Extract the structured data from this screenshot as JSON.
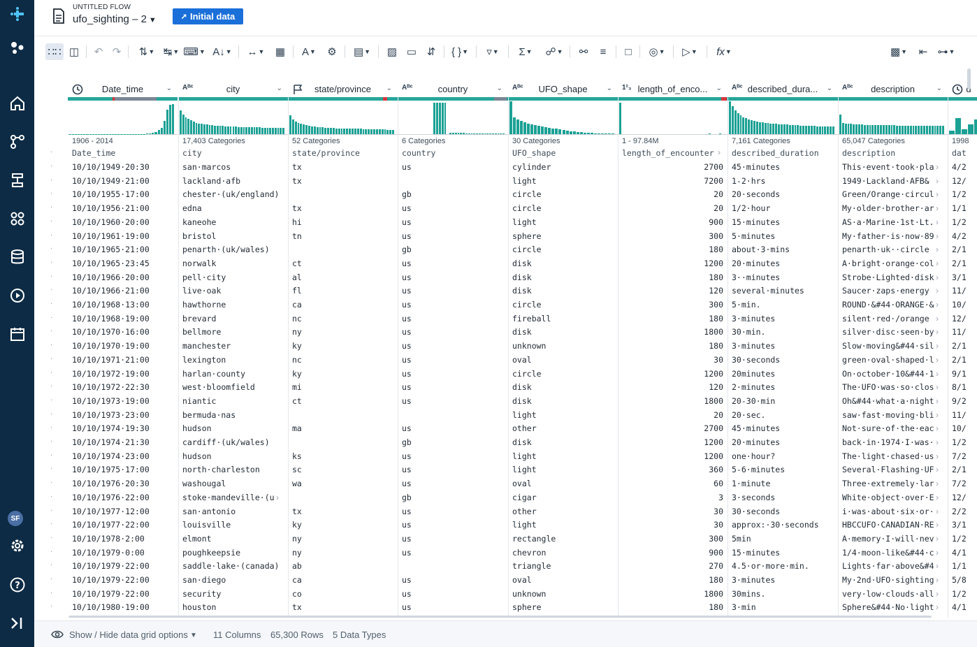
{
  "header": {
    "flow_label": "UNTITLED FLOW",
    "flow_name": "ufo_sighting – 2",
    "initial_button": "Initial data"
  },
  "rail": {
    "avatar": "SF"
  },
  "columns": [
    {
      "type": "clock",
      "name": "Date_time",
      "stat": "1906 - 2014",
      "colname": "Date_time"
    },
    {
      "type": "ABC",
      "name": "city",
      "stat": "17,403 Categories",
      "colname": "city"
    },
    {
      "type": "flag",
      "name": "state/province",
      "stat": "52 Categories",
      "colname": "state/province"
    },
    {
      "type": "ABC",
      "name": "country",
      "stat": "6 Categories",
      "colname": "country"
    },
    {
      "type": "ABC",
      "name": "UFO_shape",
      "stat": "30 Categories",
      "colname": "UFO_shape"
    },
    {
      "type": "123",
      "name": "length_of_enco...",
      "stat": "1 - 97.84M",
      "colname": "length_of_encounter"
    },
    {
      "type": "ABC",
      "name": "described_dura...",
      "stat": "7,161 Categories",
      "colname": "described_duration"
    },
    {
      "type": "ABC",
      "name": "description",
      "stat": "65,047 Categories",
      "colname": "description"
    },
    {
      "type": "clock",
      "name": "d",
      "stat": "1998",
      "colname": "dat"
    }
  ],
  "rows": [
    [
      "10/10/1949·20:30",
      "san·marcos",
      "tx",
      "us",
      "cylinder",
      "2700",
      "45·minutes",
      "This·event·took·pla",
      "4/2"
    ],
    [
      "10/10/1949·21:00",
      "lackland·afb",
      "tx",
      "",
      "light",
      "7200",
      "1-2·hrs",
      "1949·Lackland·AFB&",
      "12/"
    ],
    [
      "10/10/1955·17:00",
      "chester·(uk/england)",
      "",
      "gb",
      "circle",
      "20",
      "20·seconds",
      "Green/Orange·circul",
      "1/2"
    ],
    [
      "10/10/1956·21:00",
      "edna",
      "tx",
      "us",
      "circle",
      "20",
      "1/2·hour",
      "My·older·brother·ar",
      "1/1"
    ],
    [
      "10/10/1960·20:00",
      "kaneohe",
      "hi",
      "us",
      "light",
      "900",
      "15·minutes",
      "AS·a·Marine·1st·Lt.",
      "1/2"
    ],
    [
      "10/10/1961·19:00",
      "bristol",
      "tn",
      "us",
      "sphere",
      "300",
      "5·minutes",
      "My·father·is·now·89",
      "4/2"
    ],
    [
      "10/10/1965·21:00",
      "penarth·(uk/wales)",
      "",
      "gb",
      "circle",
      "180",
      "about·3·mins",
      "penarth·uk··circle",
      "2/1"
    ],
    [
      "10/10/1965·23:45",
      "norwalk",
      "ct",
      "us",
      "disk",
      "1200",
      "20·minutes",
      "A·bright·orange·col",
      "2/1"
    ],
    [
      "10/10/1966·20:00",
      "pell·city",
      "al",
      "us",
      "disk",
      "180",
      "3··minutes",
      "Strobe·Lighted·disk",
      "3/1"
    ],
    [
      "10/10/1966·21:00",
      "live·oak",
      "fl",
      "us",
      "disk",
      "120",
      "several·minutes",
      "Saucer·zaps·energy",
      "11/"
    ],
    [
      "10/10/1968·13:00",
      "hawthorne",
      "ca",
      "us",
      "circle",
      "300",
      "5·min.",
      "ROUND·&#44·ORANGE·&",
      "10/"
    ],
    [
      "10/10/1968·19:00",
      "brevard",
      "nc",
      "us",
      "fireball",
      "180",
      "3·minutes",
      "silent·red·/orange",
      "12/"
    ],
    [
      "10/10/1970·16:00",
      "bellmore",
      "ny",
      "us",
      "disk",
      "1800",
      "30·min.",
      "silver·disc·seen·by",
      "11/"
    ],
    [
      "10/10/1970·19:00",
      "manchester",
      "ky",
      "us",
      "unknown",
      "180",
      "3·minutes",
      "Slow·moving&#44·sil",
      "2/1"
    ],
    [
      "10/10/1971·21:00",
      "lexington",
      "nc",
      "us",
      "oval",
      "30",
      "30·seconds",
      "green·oval·shaped·l",
      "2/1"
    ],
    [
      "10/10/1972·19:00",
      "harlan·county",
      "ky",
      "us",
      "circle",
      "1200",
      "20minutes",
      "On·october·10&#44·1",
      "9/1"
    ],
    [
      "10/10/1972·22:30",
      "west·bloomfield",
      "mi",
      "us",
      "disk",
      "120",
      "2·minutes",
      "The·UFO·was·so·clos",
      "8/1"
    ],
    [
      "10/10/1973·19:00",
      "niantic",
      "ct",
      "us",
      "disk",
      "1800",
      "20-30·min",
      "Oh&#44·what·a·night",
      "9/2"
    ],
    [
      "10/10/1973·23:00",
      "bermuda·nas",
      "",
      "",
      "light",
      "20",
      "20·sec.",
      "saw·fast·moving·bli",
      "11/"
    ],
    [
      "10/10/1974·19:30",
      "hudson",
      "ma",
      "us",
      "other",
      "2700",
      "45·minutes",
      "Not·sure·of·the·eac",
      "10/"
    ],
    [
      "10/10/1974·21:30",
      "cardiff·(uk/wales)",
      "",
      "gb",
      "disk",
      "1200",
      "20·minutes",
      "back·in·1974·I·was·",
      "1/2"
    ],
    [
      "10/10/1974·23:00",
      "hudson",
      "ks",
      "us",
      "light",
      "1200",
      "one·hour?",
      "The·light·chased·us.",
      "7/2"
    ],
    [
      "10/10/1975·17:00",
      "north·charleston",
      "sc",
      "us",
      "light",
      "360",
      "5-6·minutes",
      "Several·Flashing·UF",
      "2/1"
    ],
    [
      "10/10/1976·20:30",
      "washougal",
      "wa",
      "us",
      "oval",
      "60",
      "1·minute",
      "Three·extremely·lar",
      "7/2"
    ],
    [
      "10/10/1976·22:00",
      "stoke·mandeville·(u",
      "",
      "gb",
      "cigar",
      "3",
      "3·seconds",
      "White·object·over·E",
      "12/"
    ],
    [
      "10/10/1977·12:00",
      "san·antonio",
      "tx",
      "us",
      "other",
      "30",
      "30·seconds",
      "i·was·about·six·or·",
      "2/2"
    ],
    [
      "10/10/1977·22:00",
      "louisville",
      "ky",
      "us",
      "light",
      "30",
      "approx:·30·seconds",
      "HBCCUFO·CANADIAN·RE",
      "3/1"
    ],
    [
      "10/10/1978·2:00",
      "elmont",
      "ny",
      "us",
      "rectangle",
      "300",
      "5min",
      "A·memory·I·will·nev",
      "1/2"
    ],
    [
      "10/10/1979·0:00",
      "poughkeepsie",
      "ny",
      "us",
      "chevron",
      "900",
      "15·minutes",
      "1/4·moon-like&#44·c",
      "4/1"
    ],
    [
      "10/10/1979·22:00",
      "saddle·lake·(canada)",
      "ab",
      "",
      "triangle",
      "270",
      "4.5·or·more·min.",
      "Lights·far·above&#4",
      "1/1"
    ],
    [
      "10/10/1979·22:00",
      "san·diego",
      "ca",
      "us",
      "oval",
      "180",
      "3·minutes",
      "My·2nd·UFO·sighting",
      "5/8"
    ],
    [
      "10/10/1979·22:00",
      "security",
      "co",
      "us",
      "unknown",
      "1800",
      "30mins.",
      "very·low·clouds·all",
      "1/2"
    ],
    [
      "10/10/1980·19:00",
      "houston",
      "tx",
      "us",
      "sphere",
      "180",
      "3·min",
      "Sphere&#44·No·light",
      "4/1"
    ]
  ],
  "footer": {
    "toggle_label": "Show / Hide data grid options",
    "columns": "11 Columns",
    "rows": "65,300 Rows",
    "types": "5 Data Types"
  }
}
